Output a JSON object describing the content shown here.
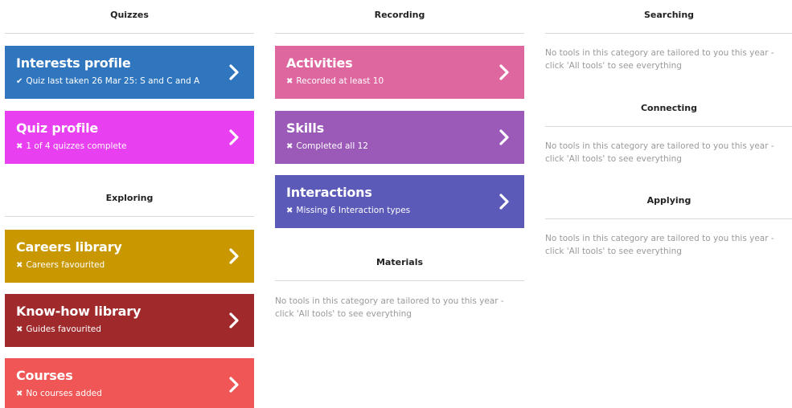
{
  "columns": [
    {
      "sections": [
        {
          "title": "Quizzes",
          "tiles": [
            {
              "title": "Interests profile",
              "status_mark": "✔",
              "status": "Quiz last taken 26 Mar 25: S and C and A",
              "color": "#2f76bf"
            },
            {
              "title": "Quiz profile",
              "status_mark": "✖",
              "status": "1 of 4 quizzes complete",
              "color": "#e83ff0"
            }
          ]
        },
        {
          "title": "Exploring",
          "tiles": [
            {
              "title": "Careers library",
              "status_mark": "✖",
              "status": "Careers favourited",
              "color": "#c99700"
            },
            {
              "title": "Know-how library",
              "status_mark": "✖",
              "status": "Guides favourited",
              "color": "#a0292b"
            },
            {
              "title": "Courses",
              "status_mark": "✖",
              "status": "No courses added",
              "color": "#f05656"
            }
          ]
        }
      ]
    },
    {
      "sections": [
        {
          "title": "Recording",
          "tiles": [
            {
              "title": "Activities",
              "status_mark": "✖",
              "status": "Recorded at least 10",
              "color": "#df67a0"
            },
            {
              "title": "Skills",
              "status_mark": "✖",
              "status": "Completed all 12",
              "color": "#9b59b8"
            },
            {
              "title": "Interactions",
              "status_mark": "✖",
              "status": "Missing 6 Interaction types",
              "color": "#5b5ab8"
            }
          ]
        },
        {
          "title": "Materials",
          "empty_note": "No tools in this category are tailored to you this year - click 'All tools' to see everything"
        }
      ]
    },
    {
      "sections": [
        {
          "title": "Searching",
          "empty_note": "No tools in this category are tailored to you this year - click 'All tools' to see everything"
        },
        {
          "title": "Connecting",
          "empty_note": "No tools in this category are tailored to you this year - click 'All tools' to see everything"
        },
        {
          "title": "Applying",
          "empty_note": "No tools in this category are tailored to you this year - click 'All tools' to see everything"
        }
      ]
    }
  ],
  "icons": {
    "tile_arrow": "chevron-right-icon"
  }
}
